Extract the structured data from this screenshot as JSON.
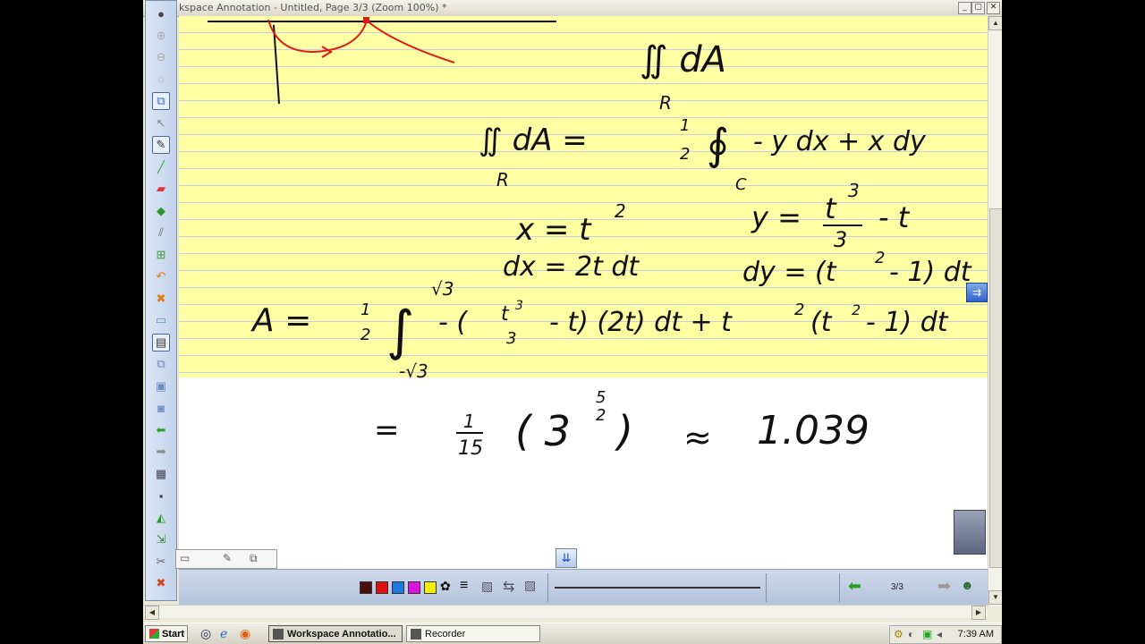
{
  "window": {
    "title": "kspace Annotation - Untitled, Page 3/3  (Zoom 100%) *",
    "controls": [
      "_",
      "▢",
      "✕"
    ]
  },
  "toolbar": {
    "tools": [
      {
        "name": "record-icon",
        "glyph": "●",
        "color": "#444"
      },
      {
        "name": "zoom-in-icon",
        "glyph": "⊕",
        "color": "#aaa"
      },
      {
        "name": "zoom-out-icon",
        "glyph": "⊖",
        "color": "#aaa"
      },
      {
        "name": "mouse-icon",
        "glyph": "◌",
        "color": "#999"
      },
      {
        "name": "copy-page-icon",
        "glyph": "⧉",
        "color": "#2f6ad0",
        "selected": true
      },
      {
        "name": "pointer-icon",
        "glyph": "↖",
        "color": "#888"
      },
      {
        "name": "pen-tool-icon",
        "glyph": "✎",
        "color": "#333",
        "selected": true
      },
      {
        "name": "highlighter-icon",
        "glyph": "╱",
        "color": "#2c9a3c"
      },
      {
        "name": "eraser-icon",
        "glyph": "▰",
        "color": "#d34"
      },
      {
        "name": "shape-icon",
        "glyph": "◆",
        "color": "#2a9a2a"
      },
      {
        "name": "line-icon",
        "glyph": "⫽",
        "color": "#666"
      },
      {
        "name": "insert-icon",
        "glyph": "⊞",
        "color": "#3a9a3a"
      },
      {
        "name": "undo-icon",
        "glyph": "↶",
        "color": "#e07a10"
      },
      {
        "name": "delete-icon",
        "glyph": "✖",
        "color": "#e07a10"
      },
      {
        "name": "new-page-icon",
        "glyph": "▭",
        "color": "#6a8ac0"
      },
      {
        "name": "page-icon",
        "glyph": "▤",
        "color": "#333",
        "selected": true
      },
      {
        "name": "pages-icon",
        "glyph": "⧉",
        "color": "#6a8ac0"
      },
      {
        "name": "folder-icon",
        "glyph": "▣",
        "color": "#6a8ac0"
      },
      {
        "name": "camera-icon",
        "glyph": "◙",
        "color": "#6a8ac0"
      },
      {
        "name": "prev-arrow-icon",
        "glyph": "⬅",
        "color": "#2aa02a"
      },
      {
        "name": "next-arrow-icon",
        "glyph": "➡",
        "color": "#8a8a8a"
      },
      {
        "name": "grid-icon",
        "glyph": "▦",
        "color": "#445"
      },
      {
        "name": "save-icon",
        "glyph": "▪",
        "color": "#445"
      },
      {
        "name": "print-icon",
        "glyph": "◭",
        "color": "#2a9a2a"
      },
      {
        "name": "export-icon",
        "glyph": "⇲",
        "color": "#2a8a2a"
      },
      {
        "name": "tools-icon",
        "glyph": "✂",
        "color": "#666"
      },
      {
        "name": "close-tool-icon",
        "glyph": "✖",
        "color": "#d9441a"
      }
    ]
  },
  "canvas": {
    "math": {
      "iint_top": "∬ dA",
      "region_top": "R",
      "green_lhs": "∬ dA =",
      "region_lhs": "R",
      "half_num": "1",
      "half_den": "2",
      "contour": "∮",
      "green_rhs": "- y dx + x dy",
      "contour_sub": "C",
      "x_eq": "x = t",
      "x_exp": "2",
      "dx_eq": "dx = 2t dt",
      "y_eq_lhs": "y =",
      "y_num": "t",
      "y_num_exp": "3",
      "y_den": "3",
      "y_tail": "- t",
      "dy_eq": "dy = (t",
      "dy_exp": "2",
      "dy_tail": "- 1) dt",
      "a_lhs": "A =",
      "a_half_num": "1",
      "a_half_den": "2",
      "int_sym": "∫",
      "int_upper": "√3",
      "int_lower": "-√3",
      "integrand_a": "- (",
      "integrand_t3": "t",
      "integrand_t3_exp": "3",
      "integrand_3": "3",
      "integrand_b": "- t) (2t) dt + t",
      "integrand_b_exp": "2",
      "integrand_c": "(t",
      "integrand_c_exp": "2",
      "integrand_d": "- 1) dt",
      "result_eq": "=",
      "result_num": "1",
      "result_den": "15",
      "result_base": "( 3",
      "result_exp_num": "5",
      "result_exp_den": "2",
      "result_close": ")",
      "approx": "≈",
      "approx_value": "1.039"
    }
  },
  "bottom_toolbar": {
    "colors": [
      "#4a1010",
      "#e01010",
      "#1a7ae0",
      "#e010e0",
      "#f0f000"
    ],
    "page_indicator": "3/3"
  },
  "taskbar": {
    "start_label": "Start",
    "tasks": [
      {
        "label": "Workspace Annotatio...",
        "active": true
      },
      {
        "label": "Recorder",
        "active": false
      }
    ],
    "clock": "7:39 AM"
  }
}
